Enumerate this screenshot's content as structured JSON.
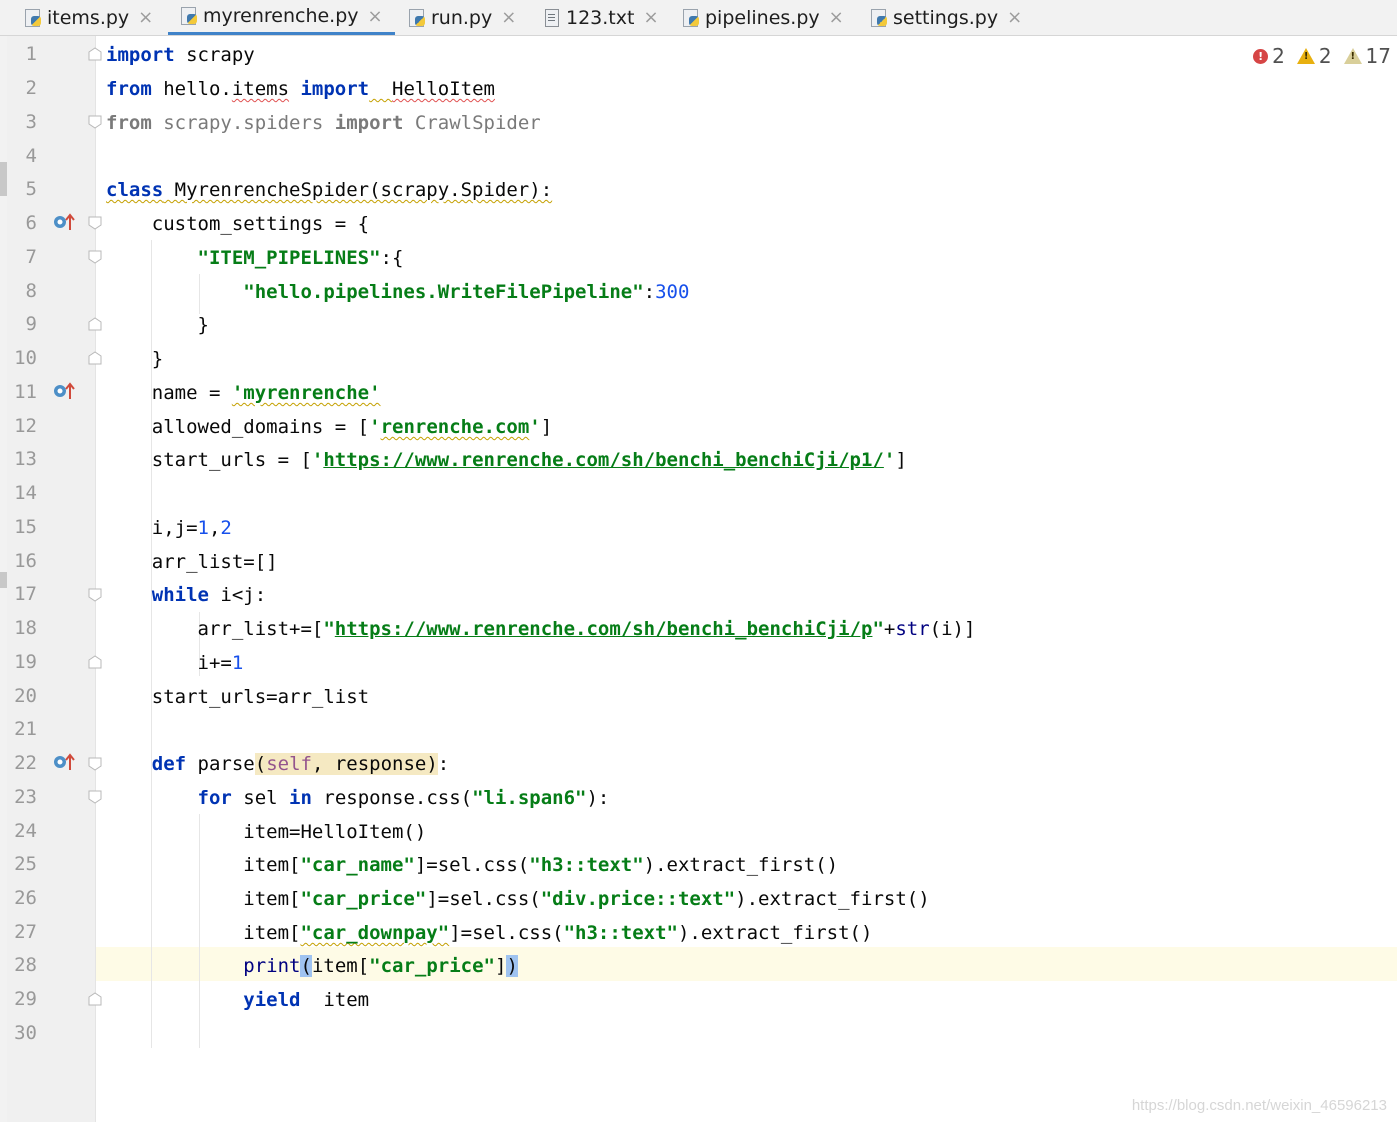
{
  "tabs": [
    {
      "label": "items.py",
      "icon": "python-file-icon"
    },
    {
      "label": "myrenrenche.py",
      "icon": "python-file-icon",
      "active": true
    },
    {
      "label": "run.py",
      "icon": "python-file-icon"
    },
    {
      "label": "123.txt",
      "icon": "text-file-icon"
    },
    {
      "label": "pipelines.py",
      "icon": "python-file-icon"
    },
    {
      "label": "settings.py",
      "icon": "python-file-icon"
    }
  ],
  "tab_close_glyph": "×",
  "inspections": {
    "errors": "2",
    "warnings": "2",
    "weak_warnings": "17"
  },
  "line_numbers": [
    "1",
    "2",
    "3",
    "4",
    "5",
    "6",
    "7",
    "8",
    "9",
    "10",
    "11",
    "12",
    "13",
    "14",
    "15",
    "16",
    "17",
    "18",
    "19",
    "20",
    "21",
    "22",
    "23",
    "24",
    "25",
    "26",
    "27",
    "28",
    "29",
    "30"
  ],
  "code": {
    "l1_kw": "import",
    "l1_rest": " scrapy",
    "l2_kw1": "from",
    "l2_mod_a": " hello.",
    "l2_mod_b": "items",
    "l2_kw2": " import",
    "l2_sp": "  ",
    "l2_name": "HelloItem",
    "l3_kw1": "from",
    "l3_mod": " scrapy.spiders ",
    "l3_kw2": "import",
    "l3_name": " CrawlSpider",
    "l5_kw": "class",
    "l5_rest": " MyrenrencheSpider(scrapy.Spider):",
    "l6": "    custom_settings = {",
    "l7_ind": "        ",
    "l7_str": "\"ITEM_PIPELINES\"",
    "l7_rest": ":{",
    "l8_ind": "            ",
    "l8_str": "\"hello.pipelines.WriteFilePipeline\"",
    "l8_colon": ":",
    "l8_num": "300",
    "l9": "        }",
    "l10": "    }",
    "l11_a": "    name = ",
    "l11_str": "'myrenrenche'",
    "l12_a": "    allowed_domains = [",
    "l12_q1": "'",
    "l12_str": "renrenche.com",
    "l12_q2": "'",
    "l12_b": "]",
    "l13_a": "    start_urls = [",
    "l13_q1": "'",
    "l13_url": "https://www.renrenche.com/sh/benchi_benchiCji/p1/",
    "l13_q2": "'",
    "l13_b": "]",
    "l15_a": "    i,j=",
    "l15_n1": "1",
    "l15_c": ",",
    "l15_n2": "2",
    "l16": "    arr_list=[]",
    "l17_ind": "    ",
    "l17_kw": "while",
    "l17_rest": " i<j:",
    "l18_a": "        arr_list+=[",
    "l18_q1": "\"",
    "l18_url": "https://www.renrenche.com/sh/benchi_benchiCji/p",
    "l18_q2": "\"",
    "l18_plus": "+",
    "l18_fn": "str",
    "l18_b": "(i)]",
    "l19_a": "        i+=",
    "l19_n": "1",
    "l20": "    start_urls=arr_list",
    "l22_ind": "    ",
    "l22_kw": "def",
    "l22_name": " parse",
    "l22_p_open": "(",
    "l22_self": "self",
    "l22_p_rest": ", response)",
    "l22_colon": ":",
    "l23_ind": "        ",
    "l23_kw1": "for",
    "l23_a": " sel ",
    "l23_kw2": "in",
    "l23_b": " response.css(",
    "l23_str": "\"li.span6\"",
    "l23_c": "):",
    "l24": "            item=HelloItem()",
    "l25_a": "            item[",
    "l25_s1": "\"car_name\"",
    "l25_b": "]=sel.css(",
    "l25_s2": "\"h3::text\"",
    "l25_c": ").extract_first()",
    "l26_a": "            item[",
    "l26_s1": "\"car_price\"",
    "l26_b": "]=sel.css(",
    "l26_s2": "\"div.price::text\"",
    "l26_c": ").extract_first()",
    "l27_a": "            item[",
    "l27_s1": "\"car_downpay\"",
    "l27_b": "]=sel.css(",
    "l27_s2": "\"h3::text\"",
    "l27_c": ").extract_first()",
    "l28_ind": "            ",
    "l28_fn": "print",
    "l28_po": "(",
    "l28_a": "item[",
    "l28_s": "\"car_price\"",
    "l28_b": "]",
    "l28_pc": ")",
    "l29_ind": "            ",
    "l29_kw": "yield",
    "l29_rest": "  item"
  },
  "watermark": "https://blog.csdn.net/weixin_46596213",
  "colors": {
    "keyword": "#0033b3",
    "string": "#067d17",
    "number": "#1750eb",
    "self": "#94558d",
    "current_line": "#fefbe6",
    "active_tab_underline": "#4083c9"
  }
}
